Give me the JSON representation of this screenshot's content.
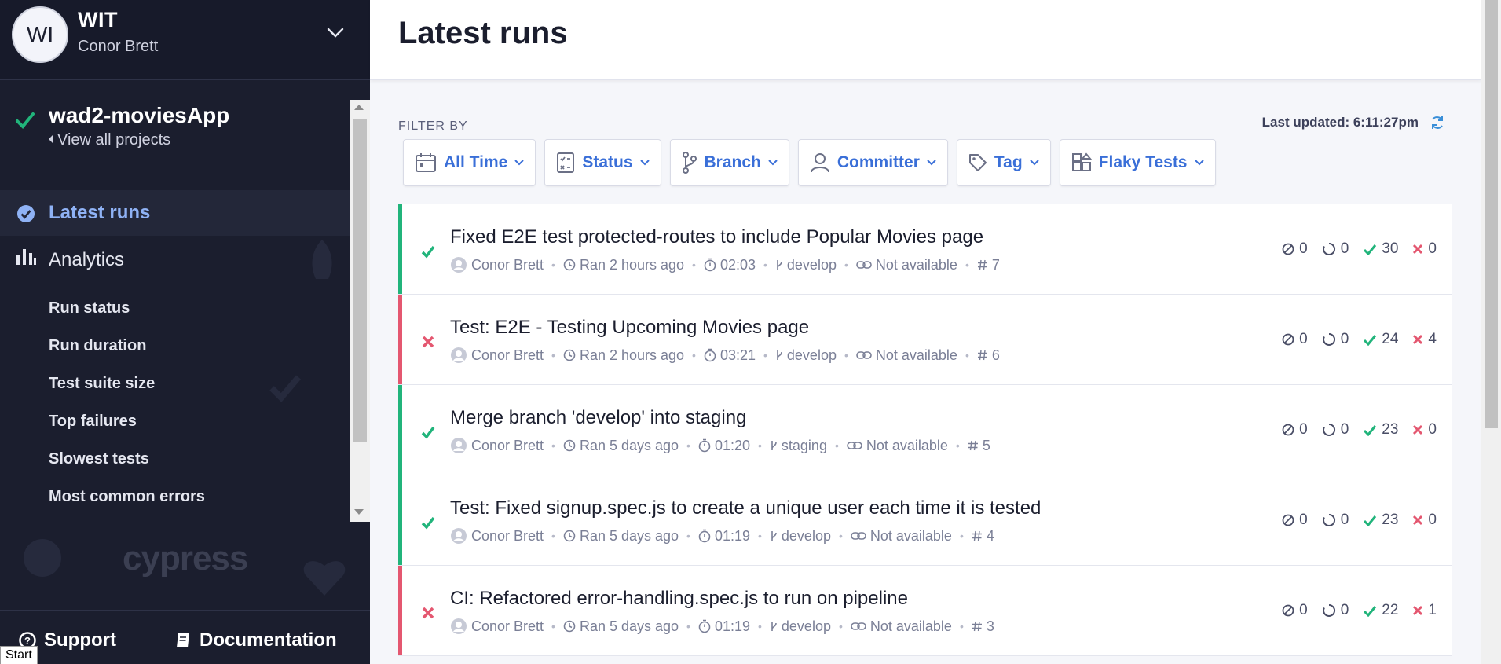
{
  "org": {
    "avatar_initials": "WI",
    "name": "WIT",
    "user": "Conor Brett"
  },
  "project": {
    "name": "wad2-moviesApp",
    "view_all": "View all projects"
  },
  "nav": {
    "latest_runs": "Latest runs",
    "analytics": "Analytics",
    "analytics_items": [
      "Run status",
      "Run duration",
      "Test suite size",
      "Top failures",
      "Slowest tests",
      "Most common errors"
    ]
  },
  "footer": {
    "support": "Support",
    "documentation": "Documentation",
    "start_tooltip": "Start"
  },
  "brand_logo": "cypress",
  "main": {
    "title": "Latest runs",
    "filter_label": "FILTER BY",
    "last_updated": "Last updated: 6:11:27pm",
    "filters": [
      "All Time",
      "Status",
      "Branch",
      "Committer",
      "Tag",
      "Flaky Tests"
    ]
  },
  "colors": {
    "passed": "#21b47b",
    "failed": "#e45770",
    "accent": "#3a6fd8",
    "sidebar_bg": "#1b1e2e"
  },
  "runs": [
    {
      "status": "passed",
      "title": "Fixed E2E test protected-routes to include Popular Movies page",
      "committer": "Conor Brett",
      "ran": "Ran 2 hours ago",
      "duration": "02:03",
      "branch": "develop",
      "ci": "Not available",
      "number": "7",
      "skipped": "0",
      "pending": "0",
      "passed": "30",
      "failed": "0"
    },
    {
      "status": "failed",
      "title": "Test: E2E - Testing Upcoming Movies page",
      "committer": "Conor Brett",
      "ran": "Ran 2 hours ago",
      "duration": "03:21",
      "branch": "develop",
      "ci": "Not available",
      "number": "6",
      "skipped": "0",
      "pending": "0",
      "passed": "24",
      "failed": "4"
    },
    {
      "status": "passed",
      "title": "Merge branch 'develop' into staging",
      "committer": "Conor Brett",
      "ran": "Ran 5 days ago",
      "duration": "01:20",
      "branch": "staging",
      "ci": "Not available",
      "number": "5",
      "skipped": "0",
      "pending": "0",
      "passed": "23",
      "failed": "0"
    },
    {
      "status": "passed",
      "title": "Test: Fixed signup.spec.js to create a unique user each time it is tested",
      "committer": "Conor Brett",
      "ran": "Ran 5 days ago",
      "duration": "01:19",
      "branch": "develop",
      "ci": "Not available",
      "number": "4",
      "skipped": "0",
      "pending": "0",
      "passed": "23",
      "failed": "0"
    },
    {
      "status": "failed",
      "title": "CI: Refactored error-handling.spec.js to run on pipeline",
      "committer": "Conor Brett",
      "ran": "Ran 5 days ago",
      "duration": "01:19",
      "branch": "develop",
      "ci": "Not available",
      "number": "3",
      "skipped": "0",
      "pending": "0",
      "passed": "22",
      "failed": "1"
    }
  ]
}
